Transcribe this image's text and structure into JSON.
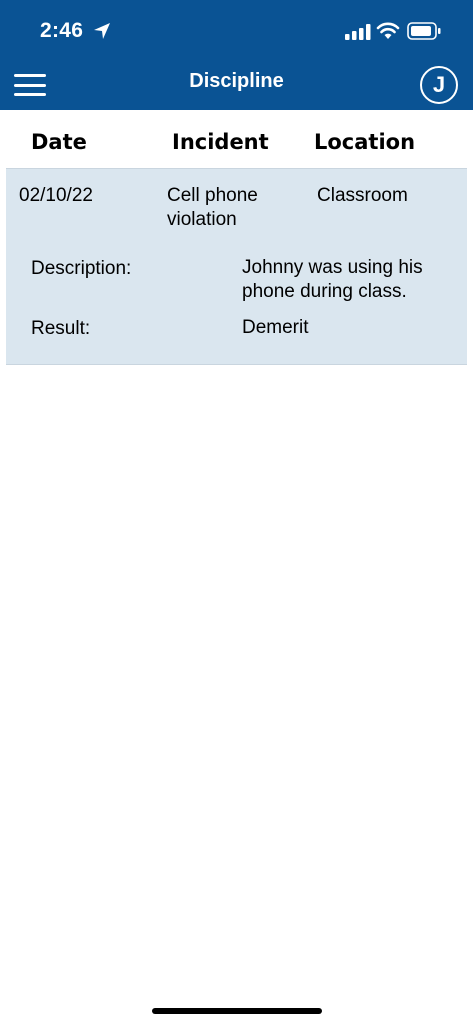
{
  "status_bar": {
    "time": "2:46"
  },
  "header": {
    "title": "Discipline",
    "avatar_initial": "J"
  },
  "table": {
    "columns": [
      "Date",
      "Incident",
      "Location"
    ],
    "rows": [
      {
        "date": "02/10/22",
        "incident": "Cell phone violation",
        "location": "Classroom",
        "description_label": "Description:",
        "description": "Johnny was using his phone during class.",
        "result_label": "Result:",
        "result": "Demerit"
      }
    ]
  },
  "colors": {
    "header_bg": "#0a5394",
    "row_bg": "#dae6ef"
  }
}
